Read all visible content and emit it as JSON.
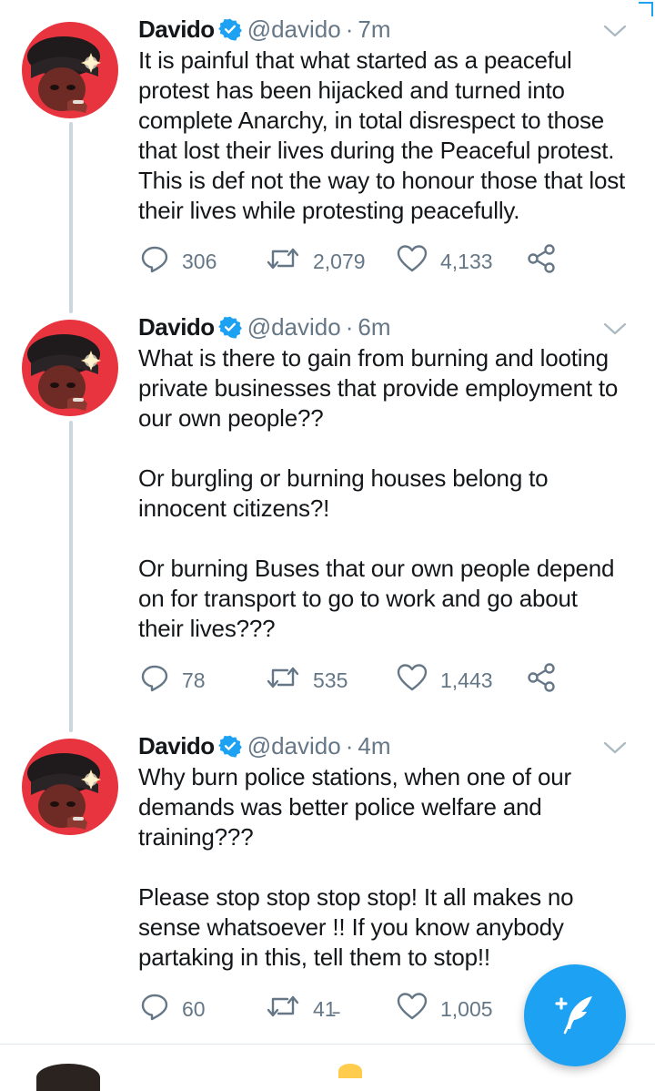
{
  "colors": {
    "accent": "#1da1f2",
    "text": "#14171a",
    "secondary": "#657786",
    "thread_line": "#ccd6dd"
  },
  "tweets": [
    {
      "name": "Davido",
      "handle": "@davido",
      "separator": "·",
      "time": "7m",
      "text": "It is painful that what started as a peaceful protest has been hijacked and turned into complete Anarchy, in total disrespect to those that lost their lives during the Peaceful protest. This is def not the way to honour those that lost their lives while protesting peacefully.",
      "replies": "306",
      "retweets": "2,079",
      "likes": "4,133"
    },
    {
      "name": "Davido",
      "handle": "@davido",
      "separator": "·",
      "time": "6m",
      "text": "What is there to gain from burning and looting private businesses that provide employment to our own people??\n\nOr burgling or burning houses belong to innocent citizens?!\n\nOr burning Buses that our own people depend on for transport to go to work and go about their lives???",
      "replies": "78",
      "retweets": "535",
      "likes": "1,443"
    },
    {
      "name": "Davido",
      "handle": "@davido",
      "separator": "·",
      "time": "4m",
      "text": "Why burn police stations, when one of our demands was better police welfare and training???\n\nPlease stop stop stop stop! It all makes no sense whatsoever !! If you know anybody partaking in this, tell them to stop!!",
      "replies": "60",
      "retweets": "41̵",
      "likes": "1,005"
    }
  ],
  "icons": {
    "verified": "verified-badge-icon",
    "caret": "chevron-down-icon",
    "reply": "reply-icon",
    "retweet": "retweet-icon",
    "like": "heart-icon",
    "share": "share-icon",
    "compose": "compose-tweet-icon"
  }
}
